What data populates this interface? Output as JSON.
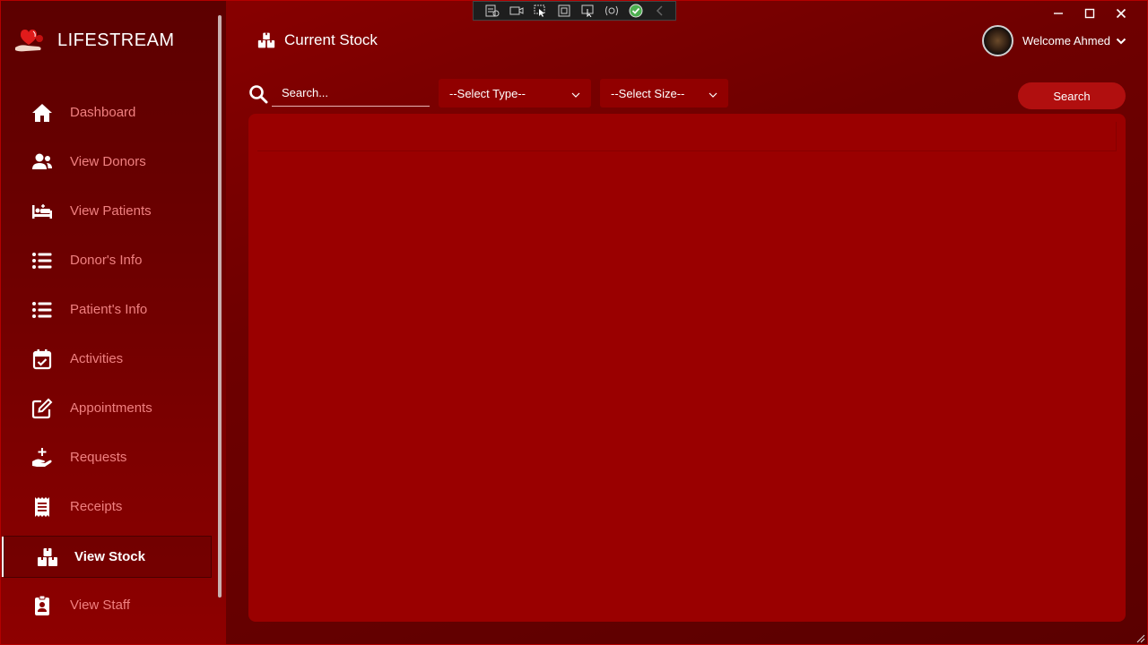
{
  "app": {
    "name": "LIFESTREAM"
  },
  "sidebar": {
    "items": [
      {
        "label": "Dashboard",
        "icon": "home-icon"
      },
      {
        "label": "View Donors",
        "icon": "users-icon"
      },
      {
        "label": "View Patients",
        "icon": "bed-icon"
      },
      {
        "label": "Donor's Info",
        "icon": "list-icon"
      },
      {
        "label": "Patient's Info",
        "icon": "list-icon"
      },
      {
        "label": "Activities",
        "icon": "calendar-check-icon"
      },
      {
        "label": "Appointments",
        "icon": "edit-icon"
      },
      {
        "label": "Requests",
        "icon": "hand-plus-icon"
      },
      {
        "label": "Receipts",
        "icon": "receipt-icon"
      },
      {
        "label": "View Stock",
        "icon": "boxes-icon",
        "active": true
      },
      {
        "label": "View Staff",
        "icon": "id-badge-icon"
      }
    ]
  },
  "header": {
    "title": "Current Stock",
    "welcome": "Welcome Ahmed"
  },
  "filters": {
    "search_placeholder": "Search...",
    "type_select": "--Select Type--",
    "size_select": "--Select Size--",
    "search_button": "Search"
  },
  "colors": {
    "accent": "#b10f0f",
    "panel": "#9a0000",
    "nav_text": "#f08080"
  }
}
